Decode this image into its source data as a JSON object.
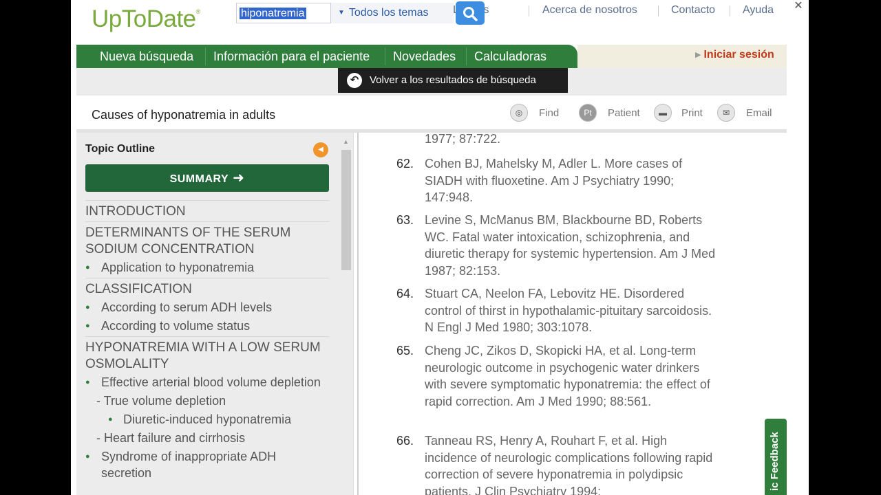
{
  "header": {
    "logo": "UpToDate",
    "logo_mark": "®",
    "search_value": "hiponatremia",
    "topic_select": "Todos los temas",
    "links": [
      "Languages",
      "Acerca de nosotros",
      "Contacto",
      "Ayuda"
    ],
    "languages_visible": "uages",
    "languages_prefix": "L"
  },
  "nav": {
    "items": [
      "Nueva búsqueda",
      "Información para el paciente",
      "Novedades",
      "Calculadoras"
    ],
    "login": "Iniciar sesión"
  },
  "back_button": "Volver a los resultados de búsqueda",
  "title": "Causes of hyponatremia in adults",
  "tools": [
    "Find",
    "Patient",
    "Print",
    "Email"
  ],
  "outline": {
    "title": "Topic Outline",
    "summary": "SUMMARY",
    "items": [
      {
        "type": "h",
        "text": "INTRODUCTION"
      },
      {
        "type": "h",
        "text": "DETERMINANTS OF THE SERUM SODIUM CONCENTRATION"
      },
      {
        "type": "b",
        "text": "Application to hyponatremia"
      },
      {
        "type": "h",
        "text": "CLASSIFICATION"
      },
      {
        "type": "b",
        "text": "According to serum ADH levels"
      },
      {
        "type": "b",
        "text": "According to volume status"
      },
      {
        "type": "h",
        "text": "HYPONATREMIA WITH A LOW SERUM OSMOLALITY"
      },
      {
        "type": "b",
        "text": "Effective arterial blood volume depletion"
      },
      {
        "type": "d",
        "text": "- True volume depletion"
      },
      {
        "type": "b2",
        "text": "Diuretic-induced hyponatremia"
      },
      {
        "type": "d",
        "text": "- Heart failure and cirrhosis"
      },
      {
        "type": "b",
        "text": "Syndrome of inappropriate ADH secretion"
      }
    ]
  },
  "references": [
    {
      "num": "",
      "text": "1977; 87:722."
    },
    {
      "num": "62.",
      "text": "Cohen BJ, Mahelsky M, Adler L. More cases of SIADH with fluoxetine. Am J Psychiatry 1990; 147:948."
    },
    {
      "num": "63.",
      "text": "Levine S, McManus BM, Blackbourne BD, Roberts WC. Fatal water intoxication, schizophrenia, and diuretic therapy for systemic hypertension. Am J Med 1987; 82:153."
    },
    {
      "num": "64.",
      "text": "Stuart CA, Neelon FA, Lebovitz HE. Disordered control of thirst in hypothalamic-pituitary sarcoidosis. N Engl J Med 1980; 303:1078."
    },
    {
      "num": "65.",
      "text": "Cheng JC, Zikos D, Skopicki HA, et al. Long-term neurologic outcome in psychogenic water drinkers with severe symptomatic hyponatremia: the effect of rapid correction. Am J Med 1990; 88:561."
    },
    {
      "num": "66.",
      "text": "Tanneau RS, Henry A, Rouhart F, et al. High incidence of neurologic complications following rapid correction of severe hyponatremia in polydipsic patients. J Clin Psychiatry 1994;"
    }
  ],
  "feedback": "Topic Feedback",
  "feedback_visible": "ic Feedback"
}
